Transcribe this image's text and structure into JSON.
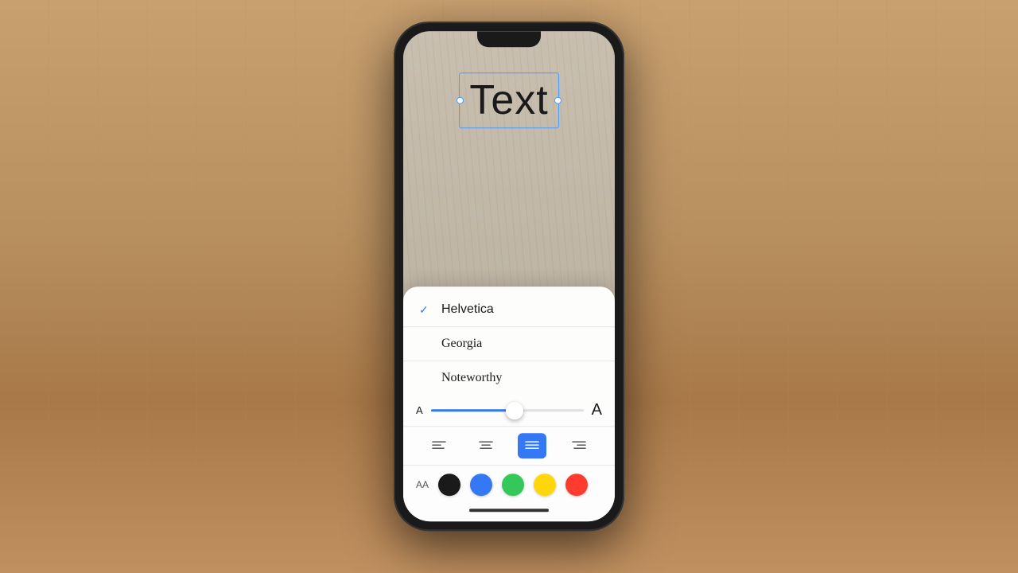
{
  "scene": {
    "background_color": "#b89060"
  },
  "phone": {
    "screen": {
      "text_element": "Text",
      "bg_color": "#c8bfb0"
    },
    "font_panel": {
      "fonts": [
        {
          "name": "Helvetica",
          "selected": true,
          "style": "helvetica"
        },
        {
          "name": "Georgia",
          "selected": false,
          "style": "georgia"
        },
        {
          "name": "Noteworthy",
          "selected": false,
          "style": "noteworthy"
        }
      ],
      "size_slider": {
        "min_label": "A",
        "max_label": "A",
        "value_percent": 55
      },
      "alignment": {
        "options": [
          "left",
          "center",
          "justify",
          "right"
        ],
        "active": "justify"
      },
      "colors": {
        "aa_label": "AA",
        "options": [
          {
            "name": "black",
            "hex": "#1a1a1a"
          },
          {
            "name": "blue",
            "hex": "#3478f6"
          },
          {
            "name": "green",
            "hex": "#34c759"
          },
          {
            "name": "yellow",
            "hex": "#ffd60a"
          },
          {
            "name": "red",
            "hex": "#ff3b30"
          }
        ]
      }
    }
  }
}
